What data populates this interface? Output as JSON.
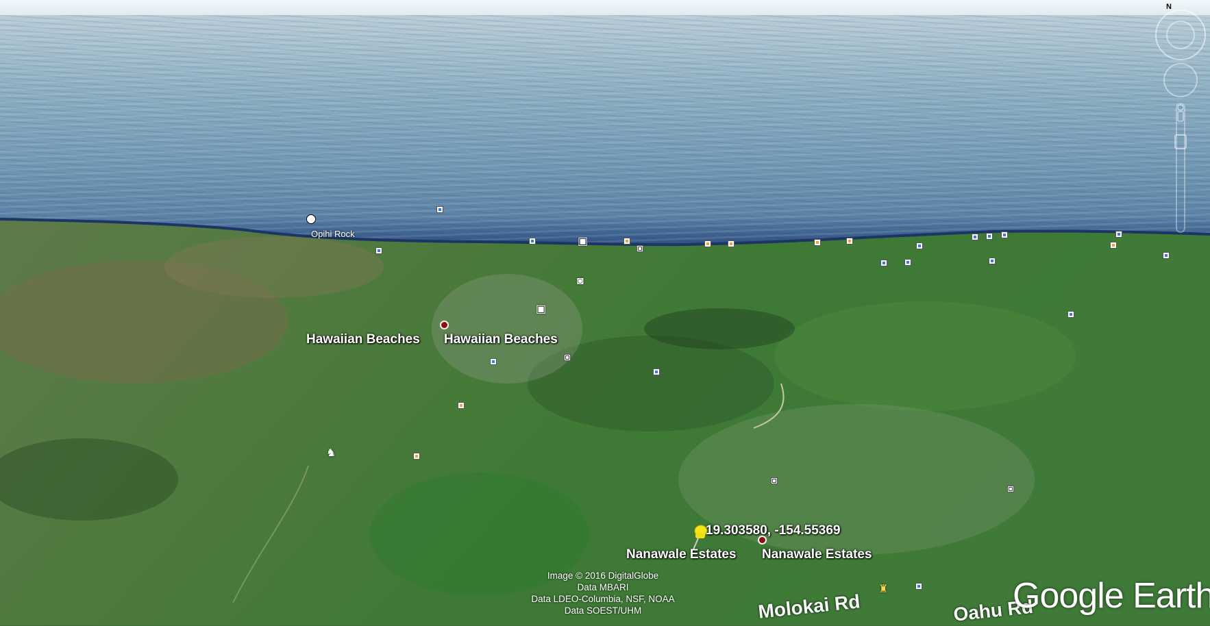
{
  "place_labels": {
    "opihi_rock": "Opihi Rock",
    "hawaiian_beaches_1": "Hawaiian Beaches",
    "hawaiian_beaches_2": "Hawaiian Beaches",
    "nanawale_estates_1": "Nanawale Estates",
    "nanawale_estates_2": "Nanawale Estates"
  },
  "pin": {
    "coordinates": "19.303580, -154.55369",
    "color": "#f7e51c"
  },
  "roads": {
    "molokai": "Molokai Rd",
    "oahu": "Oahu Rd"
  },
  "attribution": {
    "line1": "Image © 2016 DigitalGlobe",
    "line2": "Data MBARI",
    "line3": "Data LDEO-Columbia, NSF, NOAA",
    "line4": "Data SOEST/UHM"
  },
  "brand": "Google Earth",
  "nav": {
    "north_indicator": "N"
  },
  "icons": [
    "placemark-dot-icon",
    "camera-icon",
    "photo-icon",
    "hiking-icon",
    "lodging-icon",
    "pushpin-icon"
  ],
  "colors": {
    "ocean": "#6f96b2",
    "shore": "#24457a",
    "land": "#3b6a33",
    "place_dot": "#8a0e12"
  }
}
